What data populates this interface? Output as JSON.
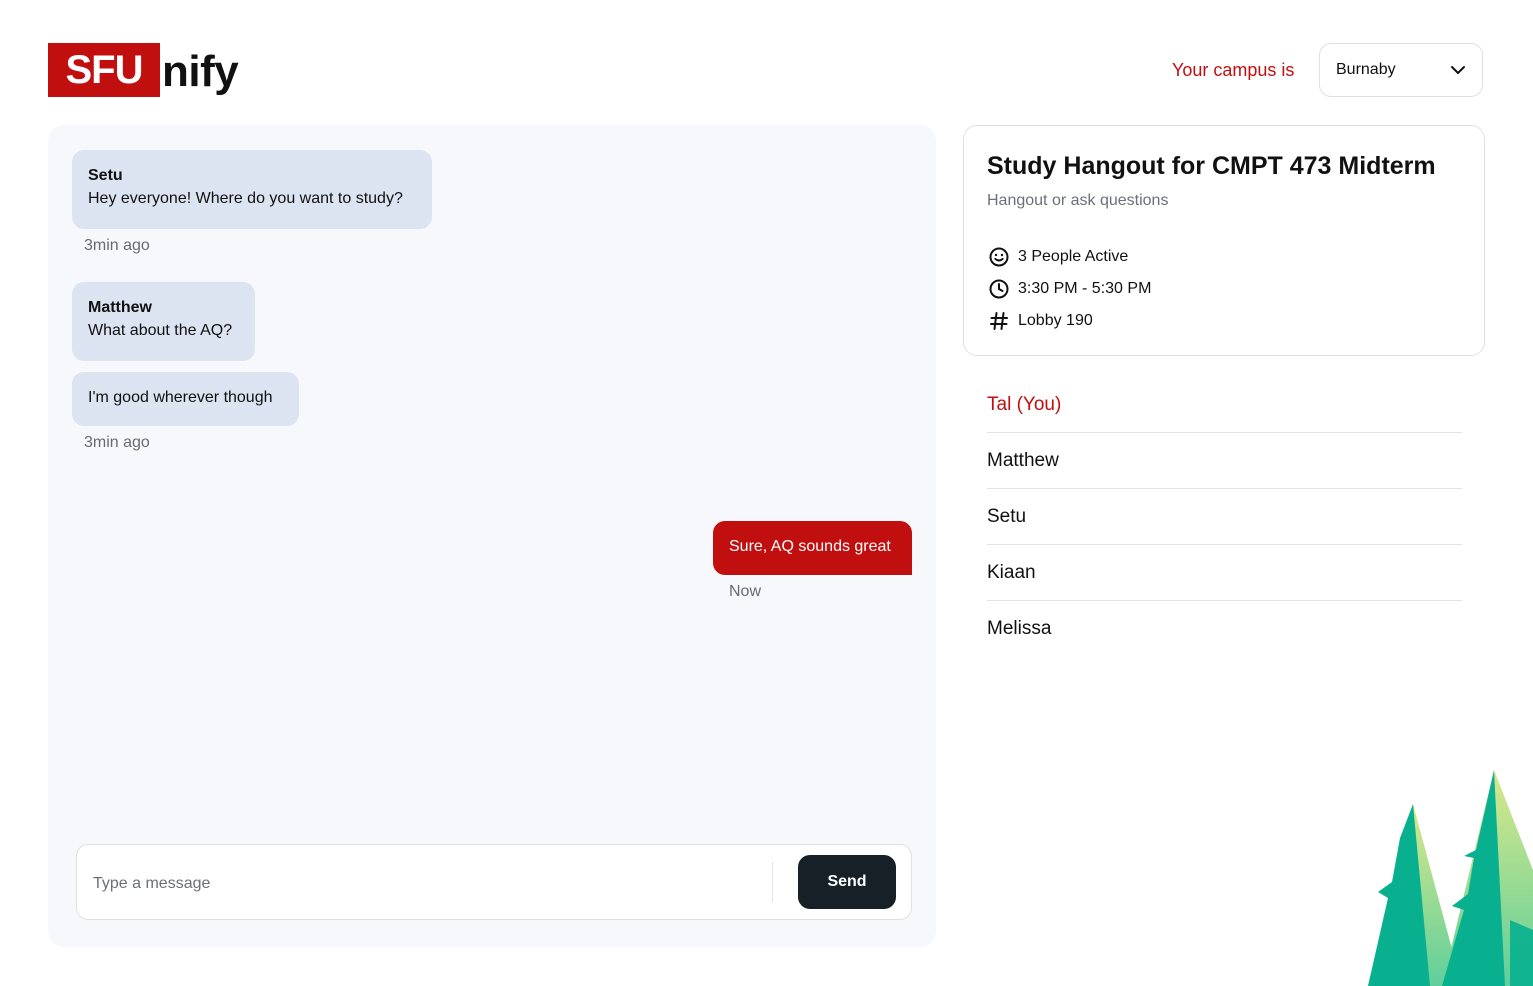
{
  "logo": {
    "box_text": "SFU",
    "rest_text": "nify"
  },
  "campus": {
    "label": "Your campus is",
    "selected": "Burnaby"
  },
  "chat": {
    "messages": [
      {
        "sender": "Setu",
        "text": "Hey everyone! Where do you want to study?"
      },
      {
        "sender": "Matthew",
        "text": "What about the AQ?"
      },
      {
        "sender": "",
        "text": "I'm good wherever though"
      },
      {
        "sender": "",
        "text": "Sure, AQ sounds great"
      }
    ],
    "timestamps": [
      "3min ago",
      "3min ago",
      "Now"
    ],
    "input_placeholder": "Type a message",
    "send_label": "Send"
  },
  "event": {
    "title": "Study Hangout for CMPT 473 Midterm",
    "subtitle": "Hangout or ask questions",
    "people_active": "3 People Active",
    "time": "3:30 PM - 5:30 PM",
    "location": "Lobby 190"
  },
  "members": [
    "Tal (You)",
    "Matthew",
    "Setu",
    "Kiaan",
    "Melissa"
  ],
  "colors": {
    "accent": "#c10f10",
    "bubble": "#dce3f1",
    "button": "#162026",
    "panel": "#f7f8fc"
  },
  "icons": {
    "dropdown": "chevron-down-icon",
    "people": "smiley-icon",
    "time": "clock-icon",
    "location": "hash-icon"
  }
}
